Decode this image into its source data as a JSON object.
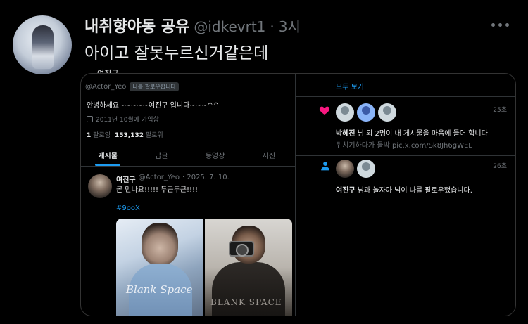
{
  "tweet": {
    "author_name": "내취향야동 공유",
    "author_handle": "@idkevrt1",
    "separator": "·",
    "time": "3시",
    "text": "아이고 잘못누르신거같은데"
  },
  "embed": {
    "cutoff_text": "여진구",
    "profile": {
      "handle": "@Actor_Yeo",
      "follows_you_badge": "나를 팔로우합니다",
      "bio": "안녕하세요~~~~~여진구 입니다~~~^^",
      "joined": "2011년 10월에 가입함",
      "following_count": "1",
      "following_label": "팔로잉",
      "followers_count": "153,132",
      "followers_label": "팔로워",
      "tabs": [
        "게시물",
        "답글",
        "동영상",
        "사진"
      ]
    },
    "post": {
      "name": "여진구",
      "handle": "@Actor_Yeo",
      "date": "· 2025. 7. 10.",
      "text": "곧 만나요!!!!! 두근두근!!!!",
      "hashtag": "#9ooX",
      "photo1_caption": "Blank Space",
      "photo2_caption": "BLANK SPACE"
    },
    "notifications": {
      "see_all": "모두 보기",
      "items": [
        {
          "time": "25초",
          "actor": "박혜진",
          "text": " 님 외 2명이 내 게시물을 마음에 들어 합니다",
          "sub": "뒤치기하다가 들박 pic.x.com/Sk8Jh6gWEL"
        },
        {
          "time": "26초",
          "actor": "여진구",
          "text": " 님과 놀자아 님이 나를 팔로우했습니다."
        }
      ]
    }
  },
  "colors": {
    "background": "#000000",
    "text_primary": "#e7e9ea",
    "text_secondary": "#71767b",
    "accent_blue": "#1d9bf0",
    "like_pink": "#f91880"
  },
  "icons": [
    "more-icon",
    "calendar-icon",
    "heart-icon",
    "person-icon"
  ]
}
